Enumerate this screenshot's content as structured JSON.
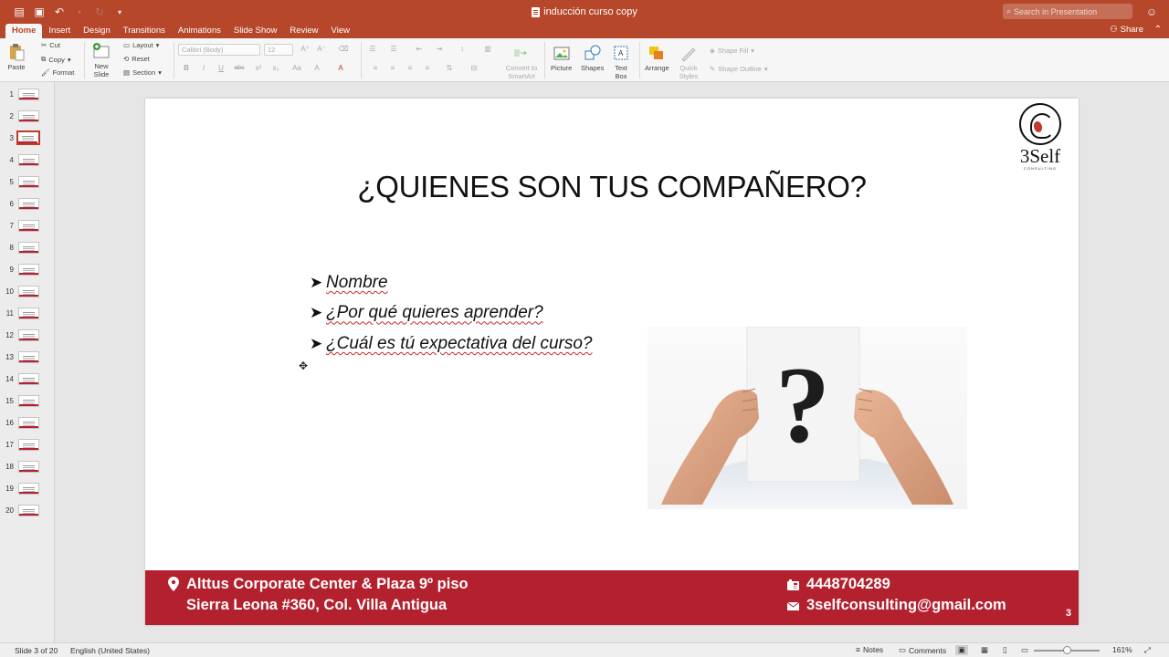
{
  "window": {
    "title": "inducción curso   copy",
    "search_placeholder": "Search in Presentation"
  },
  "tabs": [
    "Home",
    "Insert",
    "Design",
    "Transitions",
    "Animations",
    "Slide Show",
    "Review",
    "View"
  ],
  "share_label": "Share",
  "ribbon": {
    "paste": "Paste",
    "cut": "Cut",
    "copy": "Copy",
    "format": "Format",
    "new_slide": "New Slide",
    "layout": "Layout",
    "reset": "Reset",
    "section": "Section",
    "font_name": "Calibri (Body)",
    "font_size": "12",
    "convert_smartart": "Convert to SmartArt",
    "picture": "Picture",
    "shapes": "Shapes",
    "text_box": "Text Box",
    "arrange": "Arrange",
    "quick_styles": "Quick Styles",
    "shape_fill": "Shape Fill",
    "shape_outline": "Shape Outline"
  },
  "thumbnails": [
    "1",
    "2",
    "3",
    "4",
    "5",
    "6",
    "7",
    "8",
    "9",
    "10",
    "11",
    "12",
    "13",
    "14",
    "15",
    "16",
    "17",
    "18",
    "19",
    "20"
  ],
  "selected_slide": 3,
  "slide": {
    "title": "¿QUIENES SON TUS COMPAÑERO?",
    "bullets": [
      "Nombre",
      "¿Por qué quieres aprender?",
      "¿Cuál es tú expectativa del curso?"
    ],
    "logo_text": "3Self",
    "logo_sub": "CONSULTING",
    "footer": {
      "address_line1": "Alttus Corporate Center & Plaza 9º piso",
      "address_line2": "Sierra Leona #360, Col. Villa Antigua",
      "phone": "4448704289",
      "email": "3selfconsulting@gmail.com"
    },
    "page_number": "3",
    "colors": {
      "footer": "#b3202e",
      "accent": "#b7472a"
    }
  },
  "status": {
    "slide_info": "Slide 3 of 20",
    "language": "English (United States)",
    "notes": "Notes",
    "comments": "Comments",
    "zoom": "161%"
  }
}
